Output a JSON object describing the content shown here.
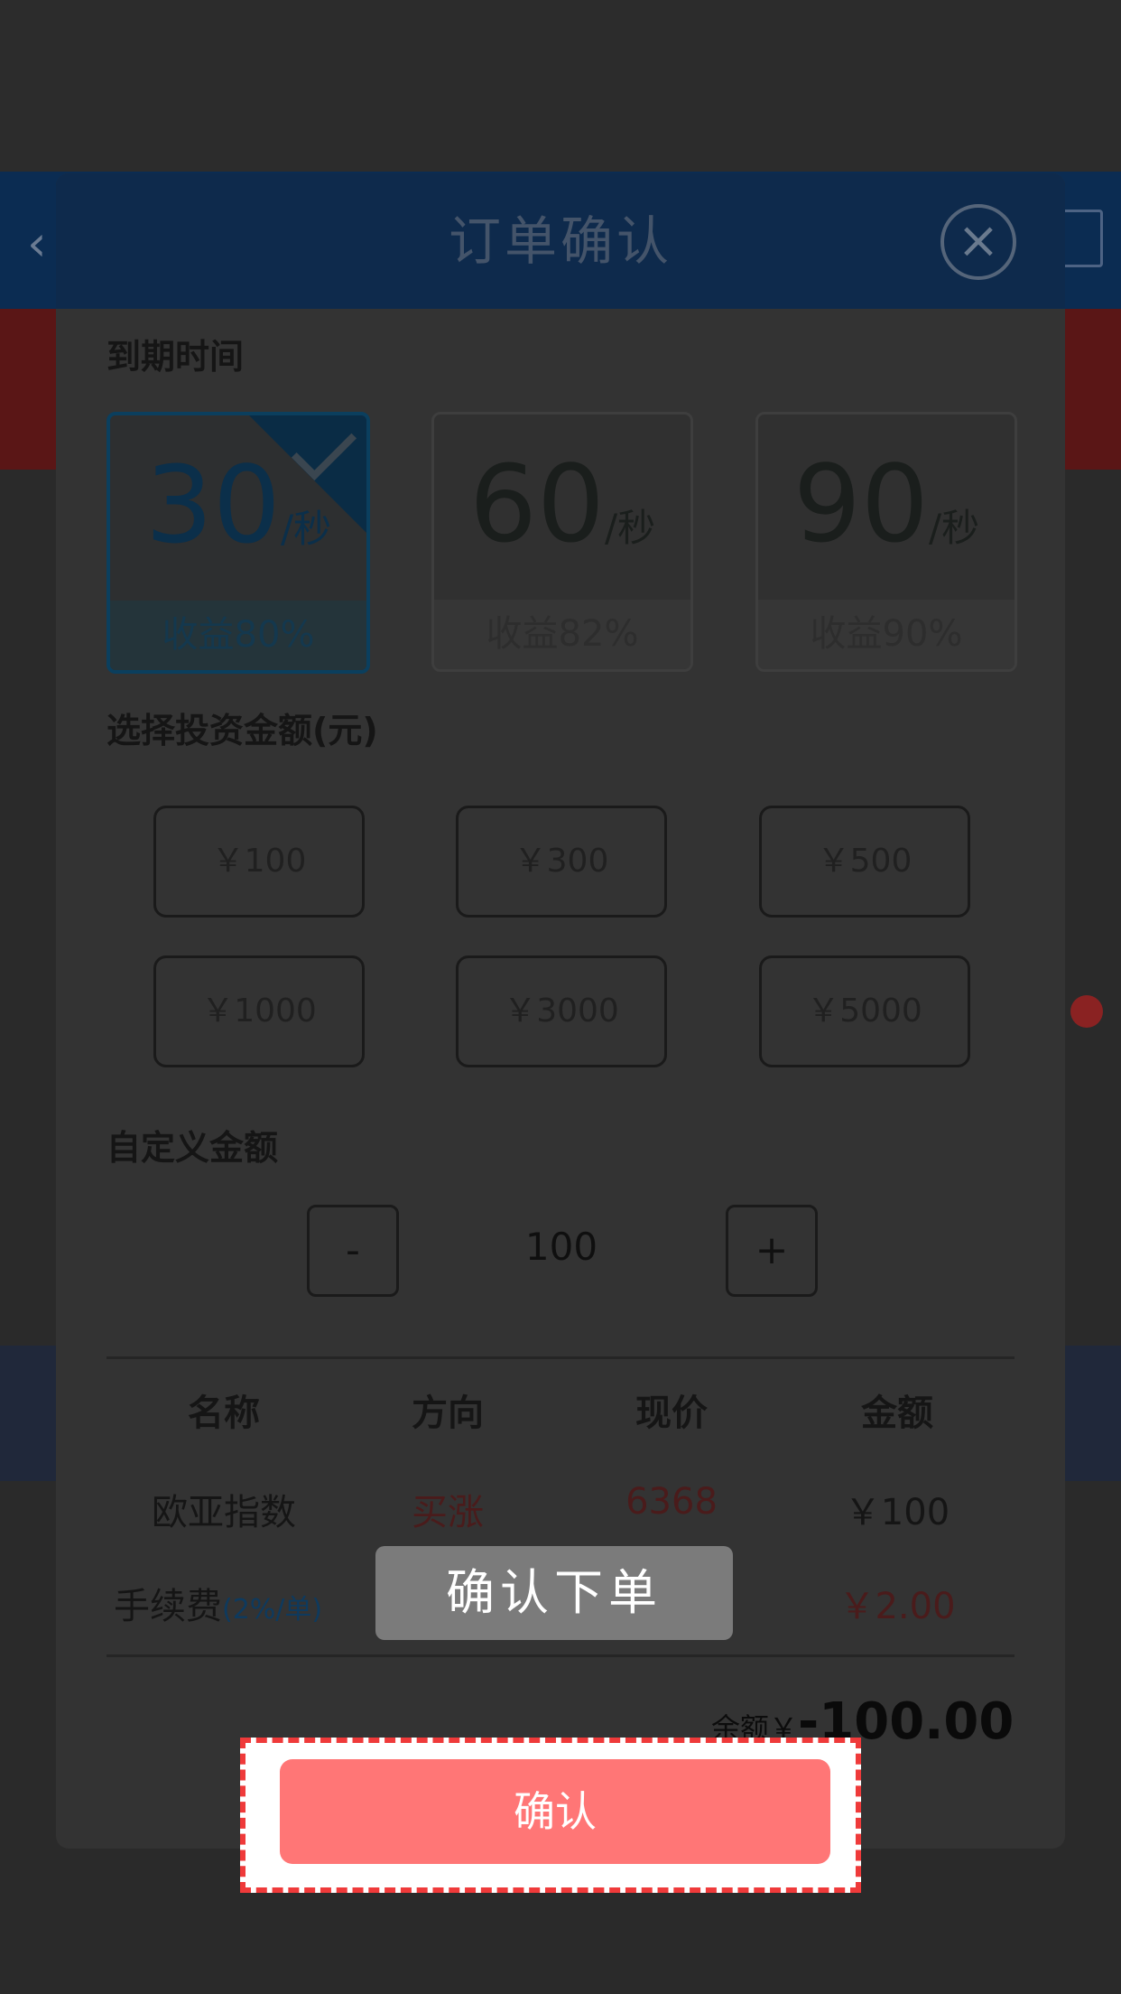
{
  "modal": {
    "title": "订单确认",
    "expiry_label": "到期时间",
    "time_options": [
      {
        "value": "30",
        "unit": "/秒",
        "rate": "收益80%",
        "selected": true
      },
      {
        "value": "60",
        "unit": "/秒",
        "rate": "收益82%",
        "selected": false
      },
      {
        "value": "90",
        "unit": "/秒",
        "rate": "收益90%",
        "selected": false
      }
    ],
    "amount_label": "选择投资金额(元)",
    "amount_options": [
      "￥100",
      "￥300",
      "￥500",
      "￥1000",
      "￥3000",
      "￥5000"
    ],
    "custom_label": "自定义金额",
    "stepper": {
      "minus": "-",
      "value": "100",
      "plus": "+"
    },
    "table": {
      "headers": [
        "名称",
        "方向",
        "现价",
        "金额"
      ],
      "row": {
        "name": "欧亚指数",
        "direction": "买涨",
        "price": "6368",
        "amount": "￥100"
      },
      "fee": {
        "label": "手续费",
        "rate": "(2%/单)",
        "amount": "￥2.00"
      }
    },
    "total": {
      "label": "余额￥",
      "value": "-100.00"
    },
    "confirm_label": "确认"
  },
  "toast": {
    "text": "确认下单"
  },
  "colors": {
    "confirm": "#ff7676",
    "highlight_border": "#ef3a3a",
    "selected_card": "#0b3f5e"
  }
}
